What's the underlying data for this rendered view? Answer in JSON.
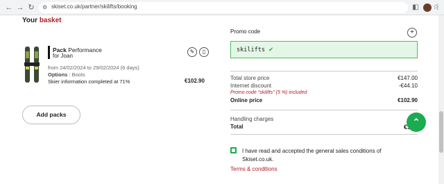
{
  "browser": {
    "url": "skiset.co.uk/partner/skilifts/booking",
    "back_icon": "←",
    "forward_icon": "→",
    "reload_icon": "↻",
    "star_icon": "☆",
    "sidebar_icon": "◧",
    "menu_icon": "⋮"
  },
  "basket": {
    "title_prefix": "Your",
    "title_accent": "basket"
  },
  "pack": {
    "label_bold": "Pack",
    "label_name": "Performance",
    "for": "for Joan",
    "dates": "from 24/02/2024 to 29/02/2024 (6 days)",
    "options_label": "Options",
    "options_value": ": Boots",
    "skier_info": "Skier information completed at 71%",
    "price": "€102.90",
    "edit_icon": "✎",
    "delete_icon": "🗑"
  },
  "add_packs_label": "Add packs",
  "promo": {
    "label": "Promo code",
    "plus_icon": "+",
    "code": "skilifts",
    "check_icon": "✔"
  },
  "summary": {
    "store_price_label": "Total store price",
    "store_price_value": "€147.00",
    "discount_label": "Internet discount",
    "discount_value": "-€44.10",
    "promo_note": "Promo code \"skilifts\" (5 %) included",
    "online_price_label": "Online price",
    "online_price_value": "€102.90",
    "handling_label": "Handling charges",
    "handling_value": "€",
    "total_label": "Total",
    "total_value": "€104"
  },
  "fab_icon": "⌃",
  "accept": {
    "text": "I have read and accepted the general sales conditions of Skiset.co.uk.",
    "terms_link": "Terms & conditions"
  },
  "colors": {
    "accent_red": "#b01c24",
    "green": "#1bab50"
  }
}
